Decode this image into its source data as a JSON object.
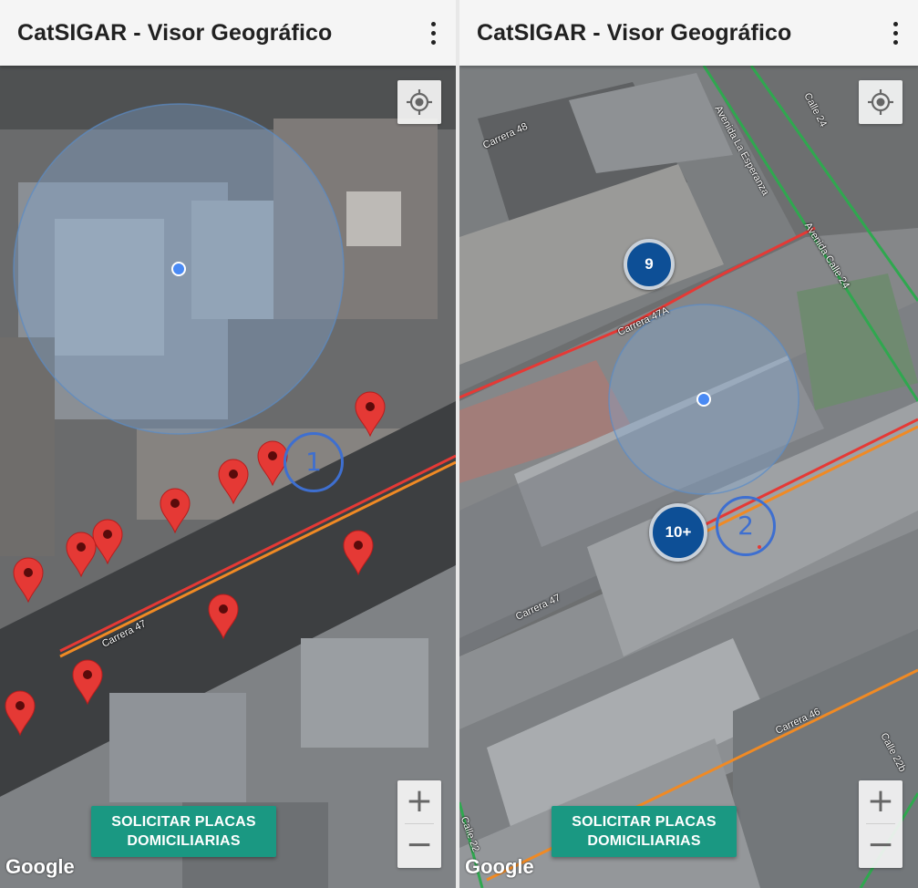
{
  "left_panel": {
    "app_bar": {
      "title": "CatSIGAR - Visor Geográfico",
      "menu_icon": "more-vert-icon"
    },
    "map": {
      "road_labels": [
        "Carrera 47"
      ],
      "my_location_icon": "my-location-icon",
      "cluster_ring_label": "1",
      "zoom_in_label": "+",
      "zoom_out_label": "−",
      "request_button_label": "SOLICITAR PLACAS DOMICILIARIAS",
      "attribution": "Google",
      "marker_color": "#e53935",
      "marker_count": 13
    }
  },
  "right_panel": {
    "app_bar": {
      "title": "CatSIGAR - Visor Geográfico",
      "menu_icon": "more-vert-icon"
    },
    "map": {
      "road_labels": [
        "Carrera 48",
        "Avenida La Esperanza",
        "Calle 24",
        "Avenida Calle 24",
        "Carrera 47A",
        "Carrera 47",
        "Carrera 46",
        "Calle 22b",
        "Calle 22"
      ],
      "my_location_icon": "my-location-icon",
      "cluster_9_label": "9",
      "cluster_10_label": "10+",
      "cluster_ring_label": "2",
      "zoom_in_label": "+",
      "zoom_out_label": "−",
      "request_button_label": "SOLICITAR PLACAS DOMICILIARIAS",
      "attribution": "Google",
      "cluster_color": "#0d4f96"
    }
  }
}
